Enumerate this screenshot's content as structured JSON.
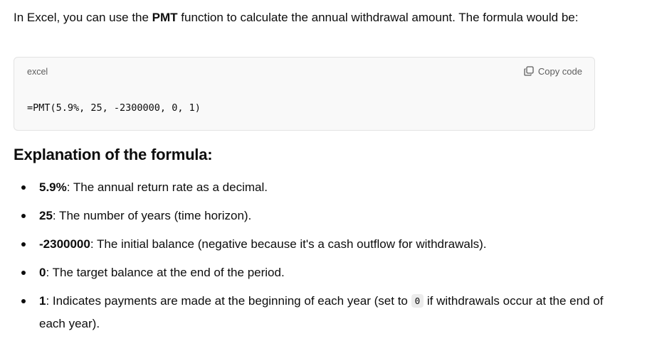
{
  "intro": {
    "before": "In Excel, you can use the ",
    "function_name": "PMT",
    "after": " function to calculate the annual withdrawal amount. The formula would be:"
  },
  "code_block": {
    "language": "excel",
    "copy_label": "Copy code",
    "copy_icon": "copy-icon",
    "code": "=PMT(5.9%, 25, -2300000, 0, 1)"
  },
  "explanation": {
    "heading": "Explanation of the formula:",
    "items": [
      {
        "term": "5.9%",
        "text": ": The annual return rate as a decimal."
      },
      {
        "term": "25",
        "text": ": The number of years (time horizon)."
      },
      {
        "term": "-2300000",
        "text": ": The initial balance (negative because it's a cash outflow for withdrawals)."
      },
      {
        "term": "0",
        "text": ": The target balance at the end of the period."
      },
      {
        "term": "1",
        "text": ": Indicates payments are made at the beginning of each year (set to ",
        "code": "0",
        "text_after": " if withdrawals occur at the end of each year)."
      }
    ]
  }
}
